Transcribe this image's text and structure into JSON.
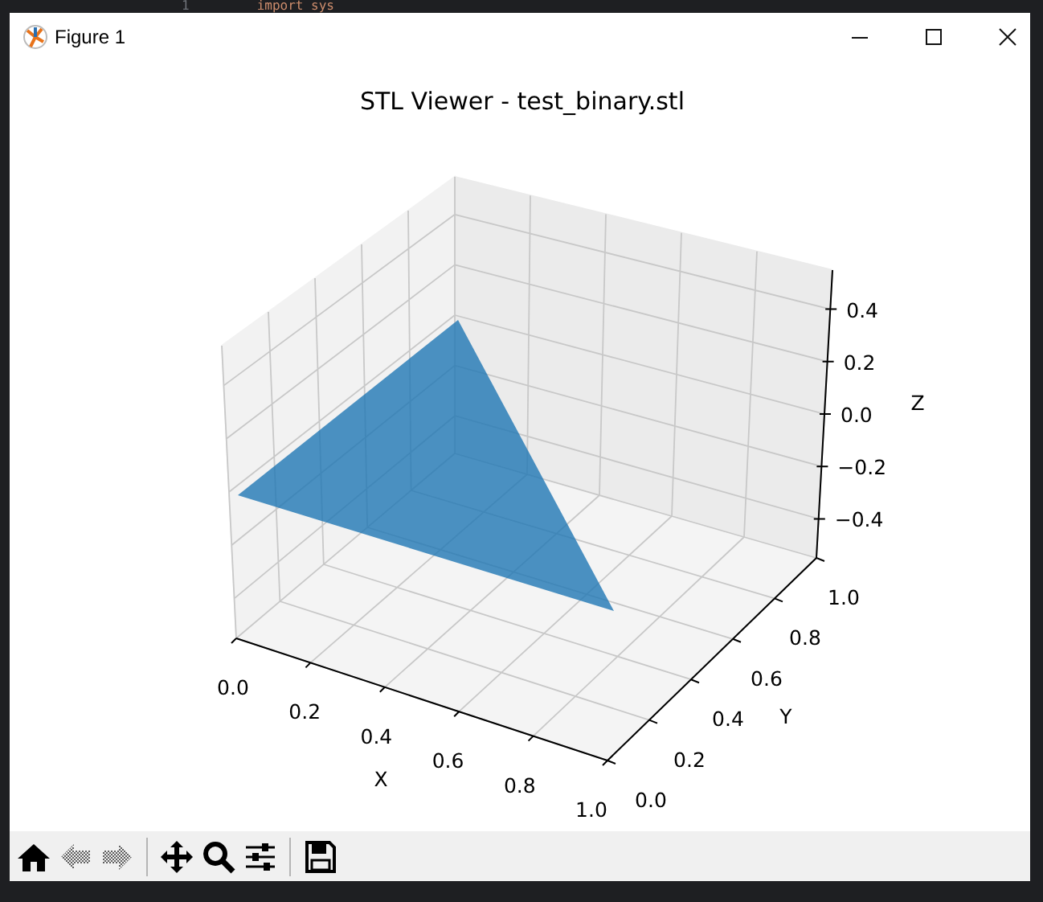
{
  "editor": {
    "line_number": "1",
    "code": "import sys"
  },
  "window": {
    "title": "Figure 1"
  },
  "plot": {
    "title": "STL Viewer - test_binary.stl",
    "x_axis": {
      "label": "X",
      "ticks": [
        "0.0",
        "0.2",
        "0.4",
        "0.6",
        "0.8",
        "1.0"
      ]
    },
    "y_axis": {
      "label": "Y",
      "ticks": [
        "0.0",
        "0.2",
        "0.4",
        "0.6",
        "0.8",
        "1.0"
      ]
    },
    "z_axis": {
      "label": "Z",
      "ticks": [
        "0.4",
        "0.2",
        "0.0",
        "−0.2",
        "−0.4"
      ]
    }
  },
  "toolbar": [
    {
      "kind": "home",
      "disabled": false
    },
    {
      "kind": "back",
      "disabled": true
    },
    {
      "kind": "forward",
      "disabled": true
    },
    {
      "kind": "separator"
    },
    {
      "kind": "pan",
      "disabled": false
    },
    {
      "kind": "zoom",
      "disabled": false
    },
    {
      "kind": "configure",
      "disabled": false
    },
    {
      "kind": "separator"
    },
    {
      "kind": "save",
      "disabled": false
    }
  ]
}
